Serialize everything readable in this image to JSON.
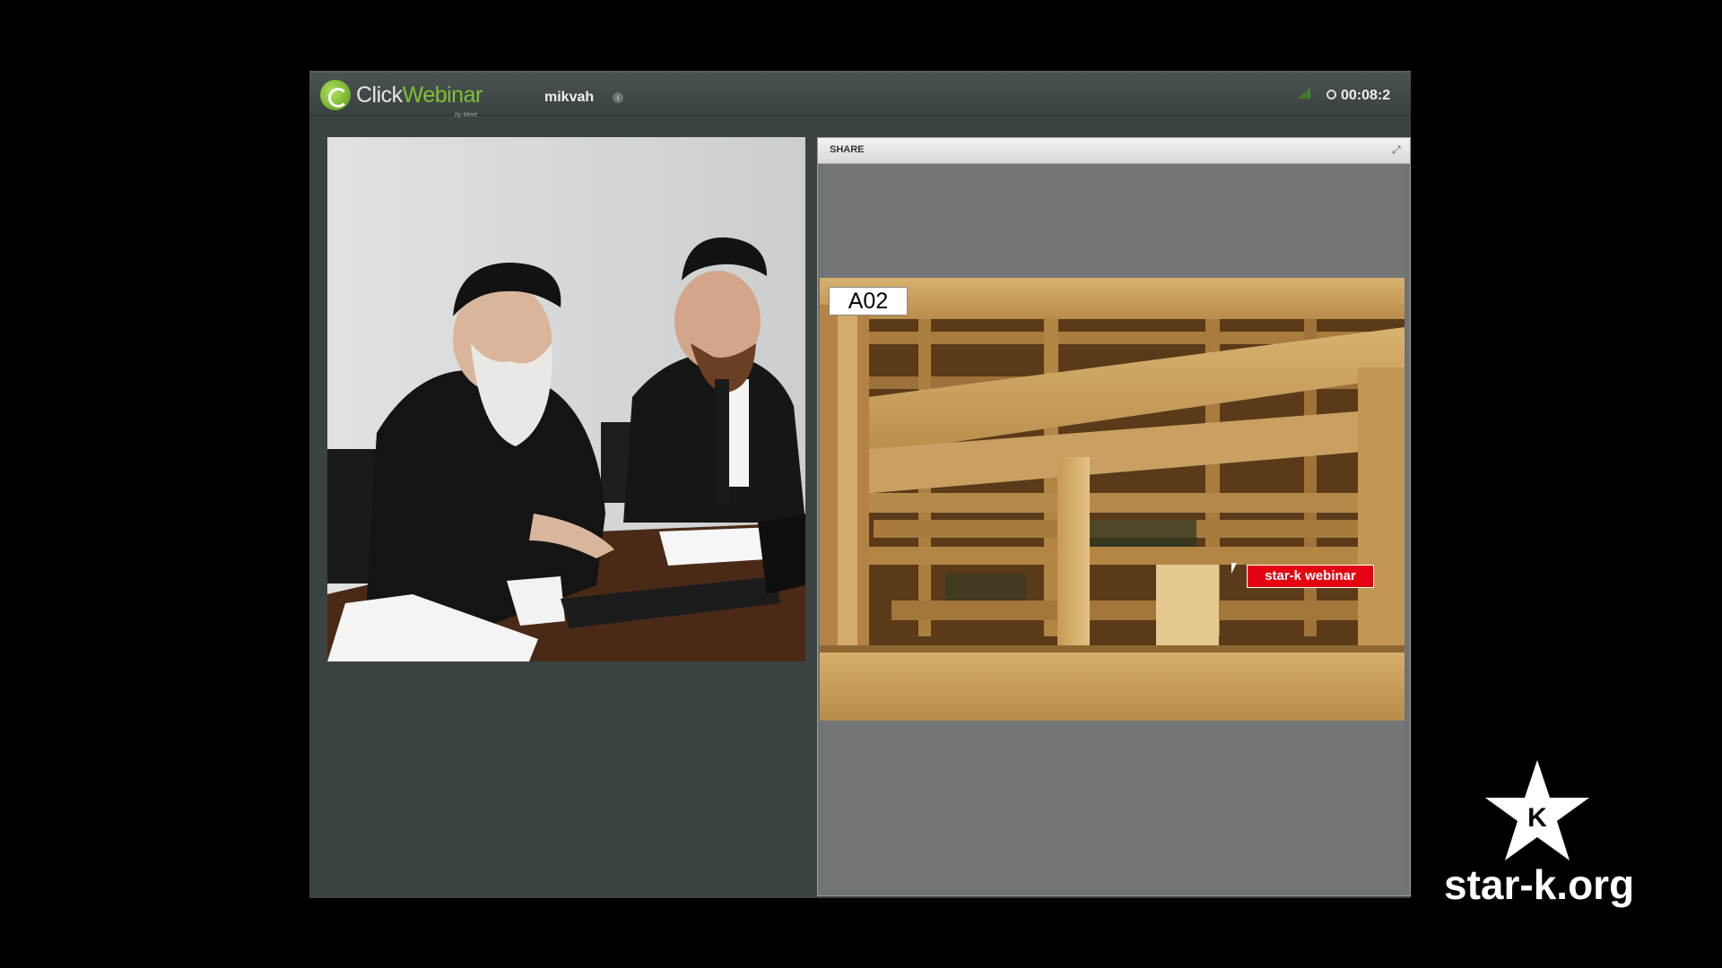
{
  "app": {
    "logo_click": "Click",
    "logo_webinar": "Webinar",
    "logo_sub": "by Meet",
    "session_name": "mikvah",
    "timer": "00:08:2"
  },
  "share": {
    "title": "SHARE",
    "slide_label": "A02",
    "tag": "star-k webinar"
  },
  "brand": {
    "star_letter": "K",
    "url": "star-k.org"
  },
  "icons": {
    "logo": "clickwebinar-logo-icon",
    "info": "info-icon",
    "signal": "signal-icon",
    "clock": "clock-icon",
    "expand": "expand-icon",
    "cursor": "cursor-icon",
    "brand": "star-k-logo-icon"
  },
  "colors": {
    "accent": "#7ec22f",
    "tag": "#e50010",
    "app_bg": "#3b4242"
  }
}
